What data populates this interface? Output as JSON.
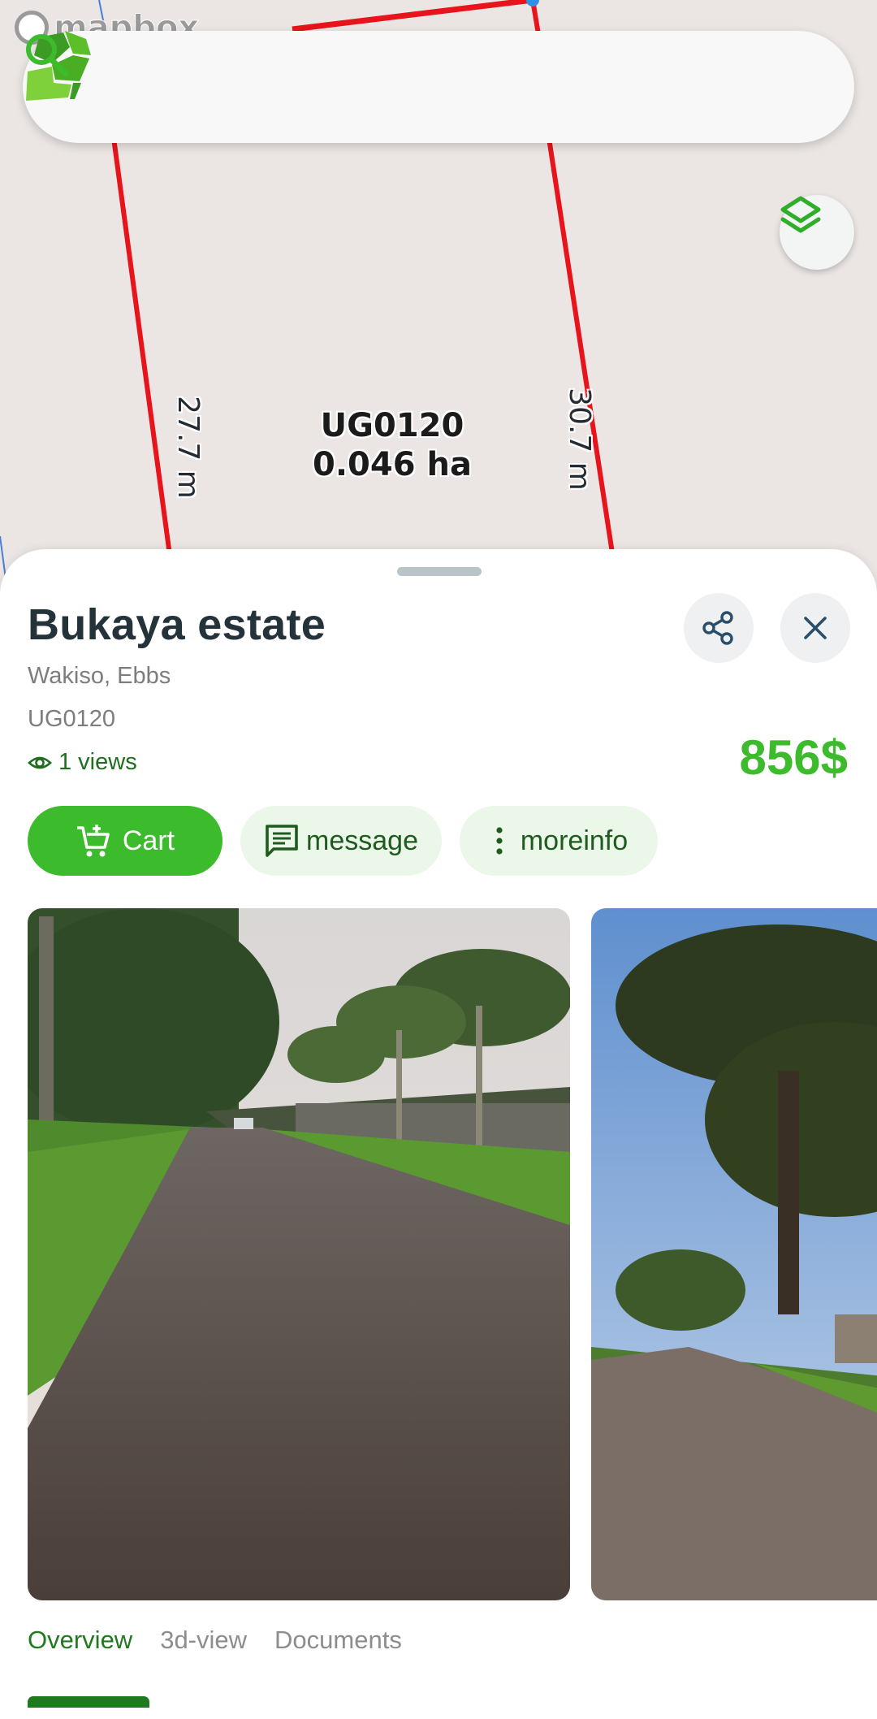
{
  "map": {
    "attribution": "mapbox",
    "parcel": {
      "code": "UG0120",
      "area": "0.046 ha",
      "left_side_length": "27.7 m",
      "right_side_length": "30.7 m"
    },
    "boundary_color": "#e8141b"
  },
  "search": {
    "placeholder": "",
    "value": ""
  },
  "listing": {
    "title": "Bukaya estate",
    "location": "Wakiso, Ebbs",
    "code": "UG0120",
    "views": "1 views",
    "price": "856$"
  },
  "actions": {
    "cart_label": "Cart",
    "message_label": "message",
    "moreinfo_label": "moreinfo"
  },
  "tabs": [
    {
      "label": "Overview",
      "active": true
    },
    {
      "label": "3d-view",
      "active": false
    },
    {
      "label": "Documents",
      "active": false
    }
  ],
  "colors": {
    "accent": "#3cbb2c",
    "accent_dark": "#1f7a1f",
    "title": "#24323a"
  }
}
